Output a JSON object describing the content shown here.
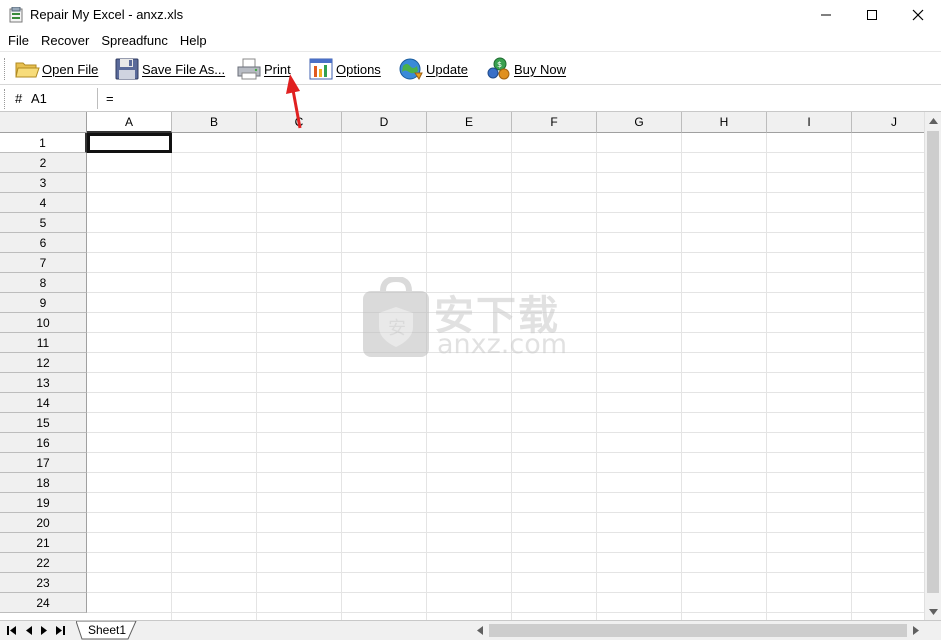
{
  "window": {
    "title": "Repair My Excel - anxz.xls"
  },
  "menu": [
    "File",
    "Recover",
    "Spreadfunc",
    "Help"
  ],
  "toolbar": {
    "open_file": "Open File",
    "save_file_as": "Save File As...",
    "print": "Print",
    "options": "Options",
    "update": "Update",
    "buy_now": "Buy Now"
  },
  "formula_bar": {
    "hash": "#",
    "cell_ref": "A1",
    "equals": "="
  },
  "columns": [
    "A",
    "B",
    "C",
    "D",
    "E",
    "F",
    "G",
    "H",
    "I",
    "J"
  ],
  "rows": [
    "1",
    "2",
    "3",
    "4",
    "5",
    "6",
    "7",
    "8",
    "9",
    "10",
    "11",
    "12",
    "13",
    "14",
    "15",
    "16",
    "17",
    "18",
    "19",
    "20",
    "21",
    "22",
    "23",
    "24"
  ],
  "active_cell": {
    "column": "A",
    "row": "1"
  },
  "sheet_tabs": [
    "Sheet1"
  ],
  "watermark": {
    "text_cn": "安下载",
    "text_en": "anxz.com"
  },
  "colors": {
    "annotation_arrow": "#e02020",
    "header_bg": "#f0f0f0",
    "gridline": "#e4e4e4"
  }
}
